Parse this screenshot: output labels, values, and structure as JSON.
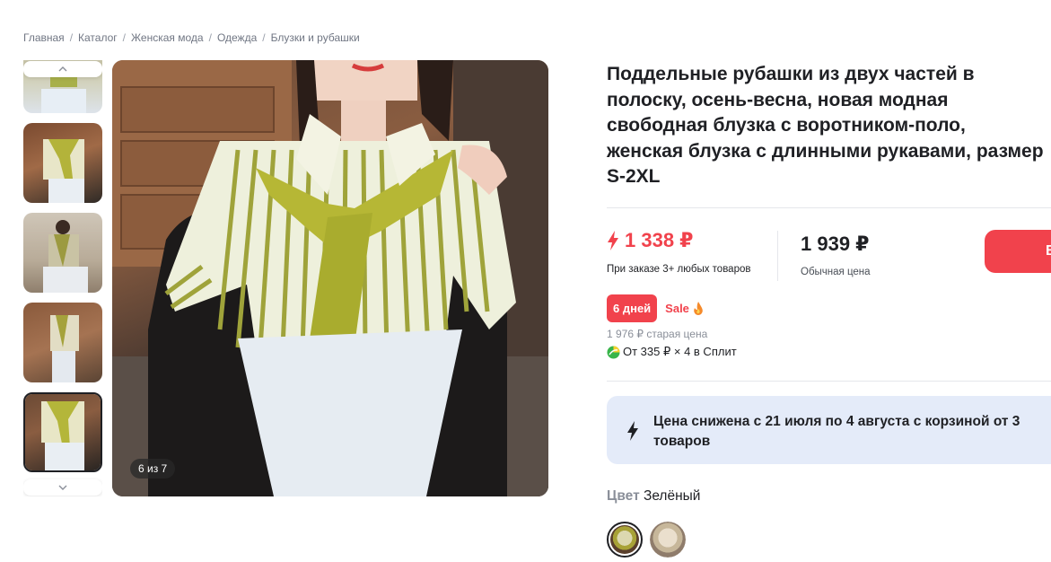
{
  "breadcrumb": [
    "Главная",
    "Каталог",
    "Женская мода",
    "Одежда",
    "Блузки и рубашки"
  ],
  "gallery": {
    "counter": "6 из 7"
  },
  "product": {
    "title": "Поддельные рубашки из двух частей в полоску, осень-весна, новая модная свободная блузка с воротником-поло, женская блузка с длинными рукавами, размер S-2XL"
  },
  "price": {
    "current": "1 338 ₽",
    "current_note": "При заказе 3+ любых товаров",
    "regular": "1 939 ₽",
    "regular_note": "Обычная цена",
    "days_badge": "6 дней",
    "sale_label": "Sale",
    "old_price_text": "1 976 ₽ старая цена",
    "split_text": "От 335 ₽ × 4 в Сплит",
    "buy_label": "В"
  },
  "promo": {
    "text": "Цена снижена с 21 июля по 4 августа с корзиной от 3 товаров"
  },
  "color": {
    "key": "Цвет",
    "value": "Зелёный"
  },
  "colors": {
    "accent": "#f1424c",
    "promo_bg": "#e4ebf9",
    "text": "#1f2024"
  }
}
